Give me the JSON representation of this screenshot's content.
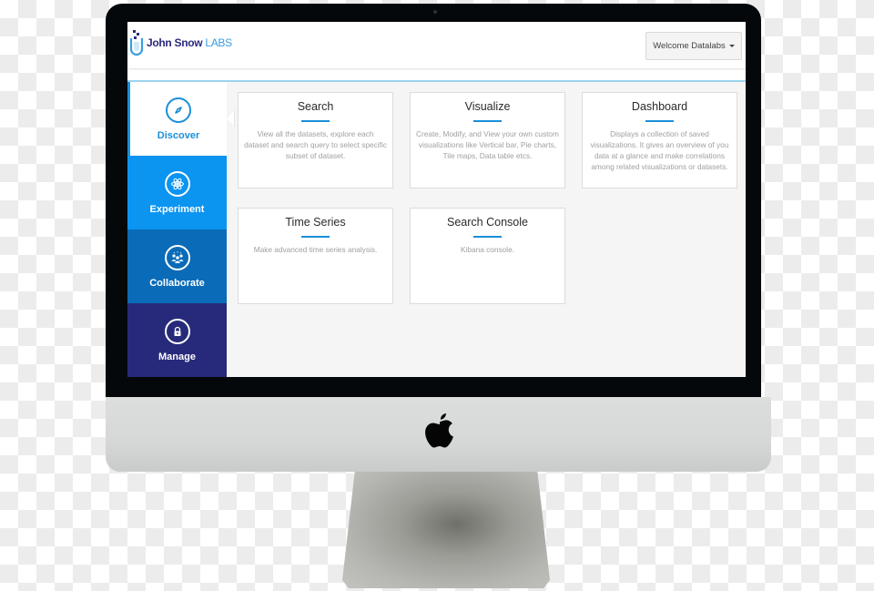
{
  "brand": {
    "name_primary": "John Snow",
    "name_secondary": " LABS",
    "primary_color": "#2b2a7e",
    "secondary_color": "#3b9de0"
  },
  "header": {
    "user_menu_label": "Welcome Datalabs",
    "user_menu_icon": "caret-down-icon"
  },
  "sidebar": {
    "items": [
      {
        "label": "Discover",
        "icon": "compass-icon",
        "active": true,
        "color": "#1a8fd8"
      },
      {
        "label": "Experiment",
        "icon": "atom-icon",
        "active": false,
        "color": "#0b94f0"
      },
      {
        "label": "Collaborate",
        "icon": "people-icon",
        "active": false,
        "color": "#0a6bb8"
      },
      {
        "label": "Manage",
        "icon": "lock-icon",
        "active": false,
        "color": "#272a7a"
      }
    ]
  },
  "cards": [
    {
      "title": "Search",
      "description": "View all the datasets, explore each dataset and search query to select specific subset of dataset."
    },
    {
      "title": "Visualize",
      "description": "Create, Modify, and View your own custom visualizations like Vertical bar, Pie charts, Tile maps, Data table etcs."
    },
    {
      "title": "Dashboard",
      "description": "Displays a collection of saved visualizations. It gives an overview of you data at a glance and make correlations among related visualizations or datasets."
    },
    {
      "title": "Time Series",
      "description": "Make advanced time series analysis."
    },
    {
      "title": "Search Console",
      "description": "Kibana console."
    }
  ],
  "device": {
    "logo_icon": "apple-logo-icon"
  }
}
